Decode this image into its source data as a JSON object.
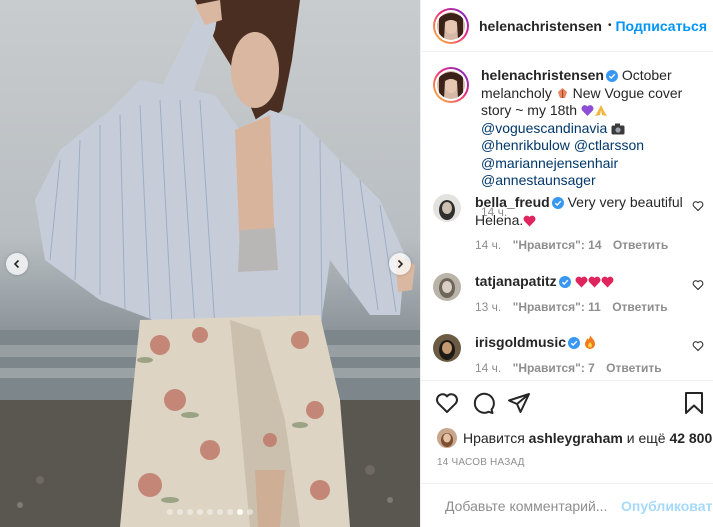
{
  "post": {
    "author": "helenachristensen",
    "follow_label": "Подписаться",
    "separator": "•",
    "image_alt_icon": "photo-carousel",
    "carousel": {
      "total": 9,
      "active_index": 7
    }
  },
  "caption": {
    "author": "helenachristensen",
    "text_1": " October melancholy ",
    "emoji_1": "leaf-icon",
    "text_2": " New Vogue cover story ~ my 18th ",
    "emoji_2": "purple-heart-icon",
    "emoji_3": "pray-icon",
    "mention_1": "@voguescandinavia",
    "emoji_4": "camera-icon",
    "mention_2": "@henrikbulow",
    "mention_3": "@ctlarsson",
    "mention_4": "@mariannejensenhair",
    "mention_5": "@annestaunsager",
    "age": "14 ч."
  },
  "comments": [
    {
      "user": "bella_freud",
      "text": "Very very beautiful Helena.",
      "age": "14 ч.",
      "likes": "\"Нравится\": 14",
      "reply": "Ответить",
      "avatar_color": "#3a3a3a"
    },
    {
      "user": "tatjanapatitz",
      "text": "",
      "age": "13 ч.",
      "likes": "\"Нравится\": 11",
      "reply": "Ответить",
      "avatar_color": "#8a8378"
    },
    {
      "user": "irisgoldmusic",
      "text": "",
      "age": "14 ч.",
      "likes": "\"Нравится\": 7",
      "reply": "Ответить",
      "avatar_color": "#2e2a24"
    }
  ],
  "likes": {
    "prefix": "Нравится",
    "user": "ashleygraham",
    "middle": "и ещё",
    "count": "42 800"
  },
  "timestamp": "14 ЧАСОВ НАЗАД",
  "composer": {
    "placeholder": "Добавьте комментарий...",
    "publish_label": "Опубликовать"
  },
  "colors": {
    "accent": "#0095f6",
    "mention": "#00376b",
    "muted": "#8e8e8e",
    "heart": "#ed4956"
  }
}
